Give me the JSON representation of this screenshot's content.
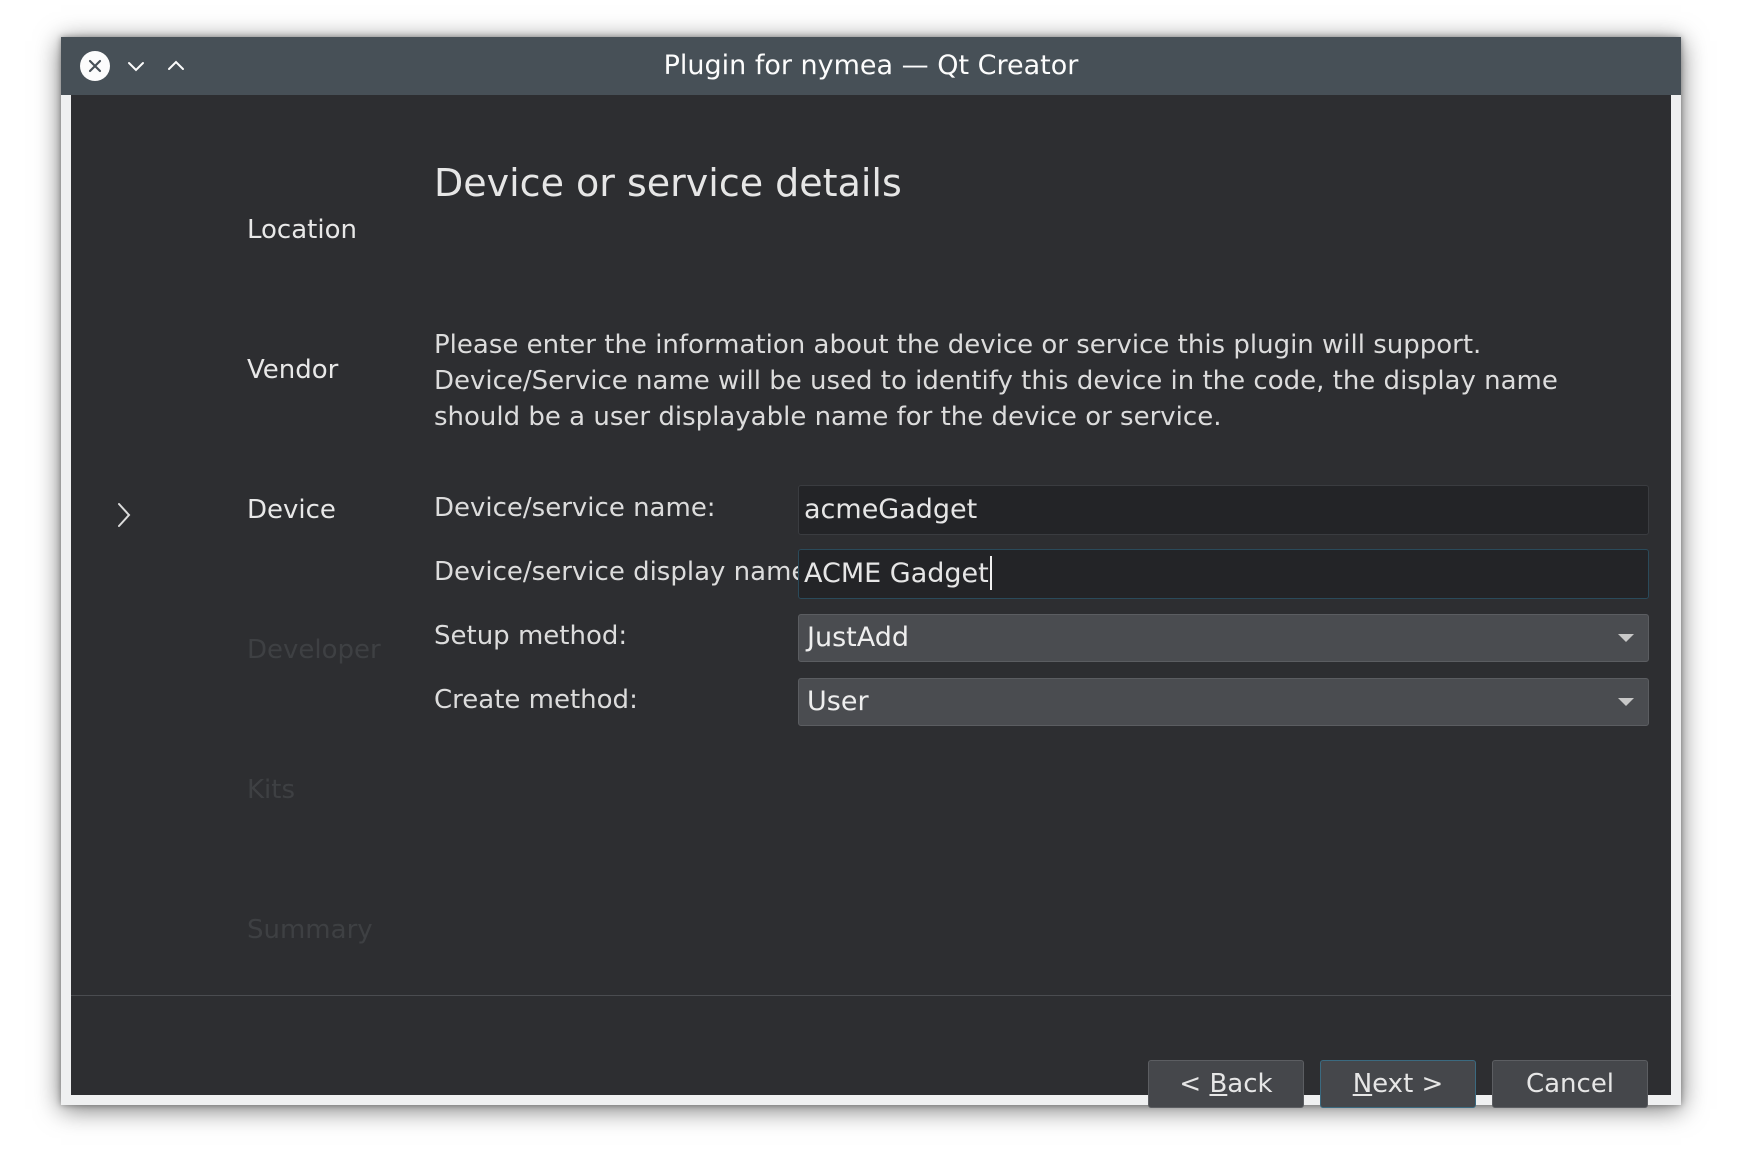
{
  "window": {
    "title": "Plugin for nymea — Qt Creator"
  },
  "icons": {
    "close": "close-icon",
    "minimize": "chevron-down-icon",
    "maximize": "chevron-up-icon",
    "current_step": "chevron-right-icon",
    "dropdown": "dropdown-arrow-icon"
  },
  "steps": [
    {
      "label": "Location",
      "state": "done"
    },
    {
      "label": "Vendor",
      "state": "done"
    },
    {
      "label": "Device",
      "state": "current"
    },
    {
      "label": "Developer",
      "state": "pending"
    },
    {
      "label": "Kits",
      "state": "pending"
    },
    {
      "label": "Summary",
      "state": "pending"
    }
  ],
  "page": {
    "heading": "Device or service details",
    "description": "Please enter the information about the device or service this plugin will support. Device/Service name will be used to identify this device in the code, the display name should be a user displayable name for the device or service."
  },
  "form": {
    "name_label": "Device/service name:",
    "name_value": "acmeGadget",
    "display_name_label": "Device/service display name:",
    "display_name_value": "ACME Gadget",
    "setup_label": "Setup method:",
    "setup_value": "JustAdd",
    "create_label": "Create method:",
    "create_value": "User"
  },
  "buttons": {
    "back_prefix": "< ",
    "back_mnemonic": "B",
    "back_rest": "ack",
    "next_mnemonic": "N",
    "next_rest": "ext >",
    "cancel": "Cancel"
  },
  "colors": {
    "titlebar": "#475057",
    "background": "#2d2e31",
    "accent": "#3b6a80"
  }
}
